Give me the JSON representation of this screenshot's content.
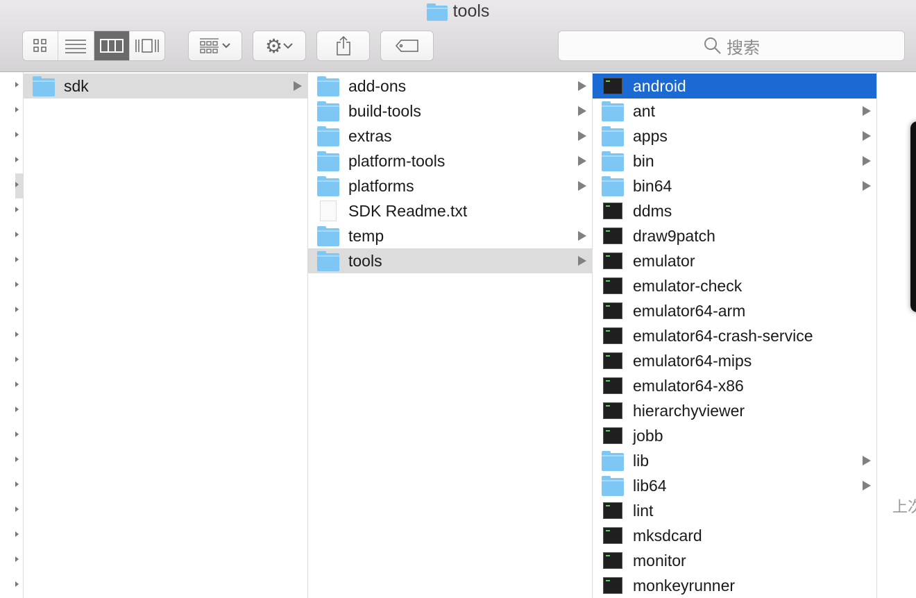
{
  "window": {
    "title": "tools"
  },
  "toolbar": {
    "views": [
      "icon-view",
      "list-view",
      "column-view",
      "cover-flow-view"
    ],
    "active_view": 2,
    "search_placeholder": "搜索"
  },
  "columns": [
    {
      "items": [
        {
          "name": "sdk",
          "type": "folder",
          "has_children": true,
          "selected": "gray"
        }
      ]
    },
    {
      "items": [
        {
          "name": "add-ons",
          "type": "folder",
          "has_children": true
        },
        {
          "name": "build-tools",
          "type": "folder",
          "has_children": true
        },
        {
          "name": "extras",
          "type": "folder",
          "has_children": true
        },
        {
          "name": "platform-tools",
          "type": "folder",
          "has_children": true
        },
        {
          "name": "platforms",
          "type": "folder",
          "has_children": true
        },
        {
          "name": "SDK Readme.txt",
          "type": "text"
        },
        {
          "name": "temp",
          "type": "folder",
          "has_children": true
        },
        {
          "name": "tools",
          "type": "folder",
          "has_children": true,
          "selected": "gray"
        }
      ]
    },
    {
      "items": [
        {
          "name": "android",
          "type": "exec",
          "selected": "blue"
        },
        {
          "name": "ant",
          "type": "folder",
          "has_children": true
        },
        {
          "name": "apps",
          "type": "folder",
          "has_children": true
        },
        {
          "name": "bin",
          "type": "folder",
          "has_children": true
        },
        {
          "name": "bin64",
          "type": "folder",
          "has_children": true
        },
        {
          "name": "ddms",
          "type": "exec"
        },
        {
          "name": "draw9patch",
          "type": "exec"
        },
        {
          "name": "emulator",
          "type": "exec"
        },
        {
          "name": "emulator-check",
          "type": "exec"
        },
        {
          "name": "emulator64-arm",
          "type": "exec"
        },
        {
          "name": "emulator64-crash-service",
          "type": "exec"
        },
        {
          "name": "emulator64-mips",
          "type": "exec"
        },
        {
          "name": "emulator64-x86",
          "type": "exec"
        },
        {
          "name": "hierarchyviewer",
          "type": "exec"
        },
        {
          "name": "jobb",
          "type": "exec"
        },
        {
          "name": "lib",
          "type": "folder",
          "has_children": true
        },
        {
          "name": "lib64",
          "type": "folder",
          "has_children": true
        },
        {
          "name": "lint",
          "type": "exec"
        },
        {
          "name": "mksdcard",
          "type": "exec"
        },
        {
          "name": "monitor",
          "type": "exec"
        },
        {
          "name": "monkeyrunner",
          "type": "exec"
        }
      ]
    }
  ],
  "preview": {
    "partial_text": "上次"
  }
}
